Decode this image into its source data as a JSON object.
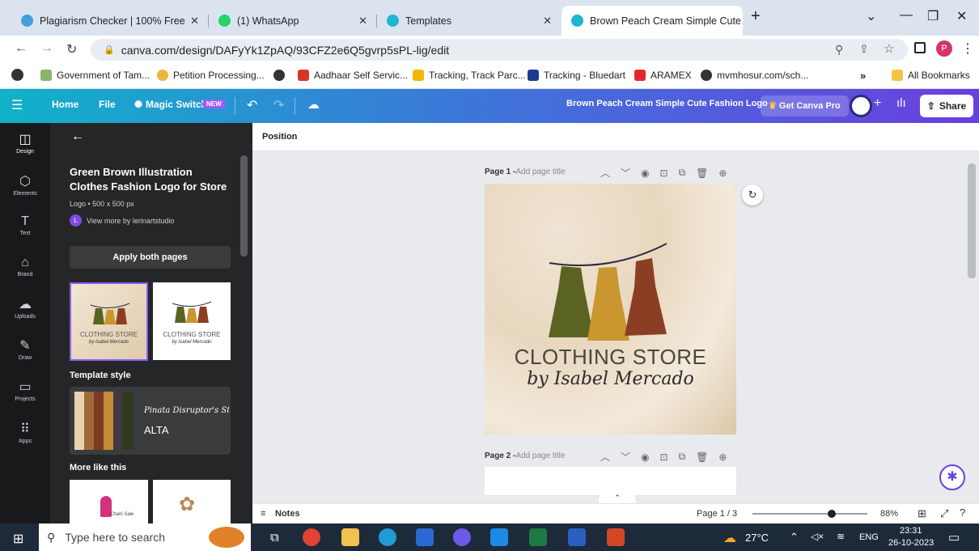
{
  "browser": {
    "tabs": [
      {
        "title": "Plagiarism Checker | 100% Free",
        "active": false
      },
      {
        "title": "(1) WhatsApp",
        "active": false
      },
      {
        "title": "Templates",
        "active": false
      },
      {
        "title": "Brown Peach Cream Simple Cute",
        "active": true
      }
    ],
    "new_tab": "+",
    "url": "canva.com/design/DAFyYk1ZpAQ/93CFZ2e6Q5gvrp5sPL-lig/edit",
    "bookmarks": [
      "Government of Tam...",
      "Petition Processing...",
      "Aadhaar Self Servic...",
      "Tracking, Track Parc...",
      "Tracking - Bluedart",
      "ARAMEX",
      "mvmhosur.com/sch..."
    ],
    "bookmarks_overflow": "»",
    "all_bookmarks": "All Bookmarks",
    "profile_initial": "P"
  },
  "canva": {
    "menu": {
      "home": "Home",
      "file": "File",
      "magic_switch": "Magic Switch",
      "new_badge": "NEW"
    },
    "design_title": "Brown Peach Cream Simple Cute Fashion Logo",
    "get_pro": "Get Canva Pro",
    "share": "Share",
    "rail": [
      "Design",
      "Elements",
      "Text",
      "Brand",
      "Uploads",
      "Draw",
      "Projects",
      "Apps"
    ],
    "panel": {
      "template_title": "Green Brown Illustration Clothes Fashion Logo for Store",
      "meta": "Logo • 500 x 500 px",
      "author": "View more by lerinartstudio",
      "author_initial": "L",
      "apply_button": "Apply both pages",
      "thumb_text_1": "CLOTHING STORE",
      "thumb_text_2": "by Isabel Mercado",
      "style_heading": "Template style",
      "style_font_1": "Pinata Disruptor's Story",
      "style_font_2": "ALTA",
      "style_colors": [
        "#e9d3b0",
        "#a06a3a",
        "#7a3b22",
        "#c48b3a",
        "#3e3a3f",
        "#2f3b1d"
      ],
      "more_heading": "More like this",
      "more_thumb_text": "Chahi Sale"
    },
    "toolbar": {
      "position": "Position"
    },
    "page1": {
      "label": "Page 1 - ",
      "placeholder": "Add page title"
    },
    "page2": {
      "label": "Page 2 - ",
      "placeholder": "Add page title"
    },
    "design": {
      "line1": "CLOTHING STORE",
      "line2": "by Isabel Mercado",
      "dress_colors": [
        "#5b6322",
        "#c9962f",
        "#8c3e24"
      ]
    },
    "status": {
      "notes": "Notes",
      "page_indicator": "Page 1 / 3",
      "zoom": "88%"
    }
  },
  "taskbar": {
    "search_placeholder": "Type here to search",
    "temperature": "27°C",
    "language": "ENG",
    "time": "23:31",
    "date": "26-10-2023"
  },
  "colors": {
    "canva_teal": "#11b2c9",
    "canva_purple": "#6a3fe0",
    "taskbar": "#1d2a3a"
  }
}
